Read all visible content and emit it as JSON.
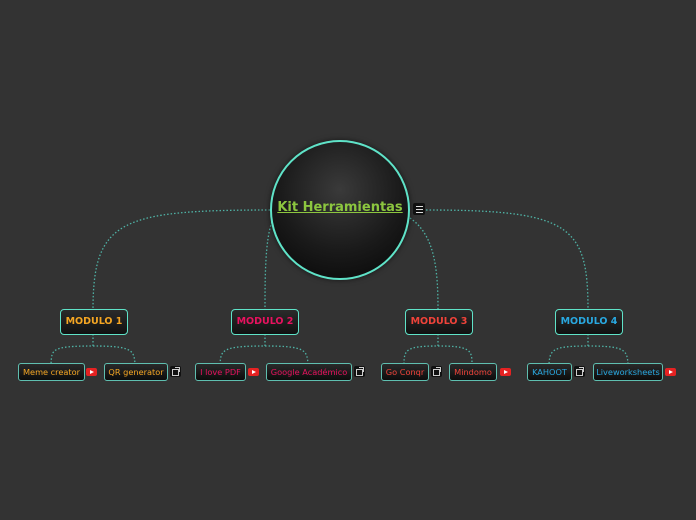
{
  "central": {
    "title": "Kit Herramientas",
    "color": "#8cc63f",
    "border_color": "#5fe3c8",
    "icon": "menu-icon"
  },
  "modules": [
    {
      "label": "MODULO 1",
      "color": "#f5a623",
      "items": [
        {
          "label": "Meme creator",
          "icon": "youtube-icon"
        },
        {
          "label": "QR generator",
          "icon": "external-link-icon"
        }
      ]
    },
    {
      "label": "MODULO 2",
      "color": "#e8125f",
      "items": [
        {
          "label": "I love PDF",
          "icon": "youtube-icon"
        },
        {
          "label": "Google Académico",
          "icon": "external-link-icon"
        }
      ]
    },
    {
      "label": "MODULO 3",
      "color": "#f0433a",
      "items": [
        {
          "label": "Go Conqr",
          "icon": "external-link-icon"
        },
        {
          "label": "Mindomo",
          "icon": "youtube-icon"
        }
      ]
    },
    {
      "label": "MODULO 4",
      "color": "#29a8e0",
      "items": [
        {
          "label": "KAHOOT",
          "icon": "external-link-icon"
        },
        {
          "label": "Liveworksheets",
          "icon": "youtube-icon"
        }
      ]
    }
  ]
}
